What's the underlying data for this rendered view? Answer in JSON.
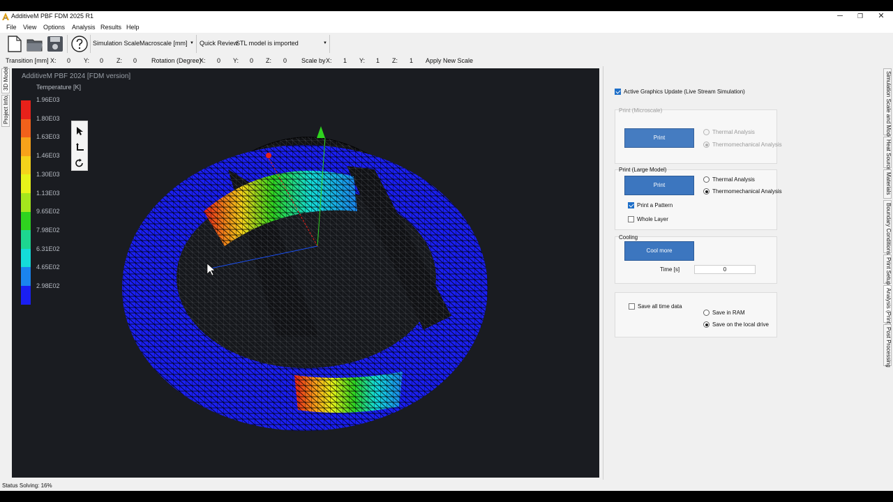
{
  "window": {
    "title": "AdditiveM PBF FDM 2025 R1",
    "minimize": "─",
    "maximize": "❐",
    "close": "✕"
  },
  "menu": [
    "File",
    "View",
    "Options",
    "Analysis",
    "Results",
    "Help"
  ],
  "toolbar": {
    "simulation_scale_label": "Simulation Scale:",
    "simulation_scale_value": "Macroscale [mm]",
    "quick_review_label": "Quick Review",
    "quick_review_value": "STL model is imported"
  },
  "transform": {
    "transition_label": "Transition [mm]",
    "transition": {
      "x": "0",
      "y": "0",
      "z": "0"
    },
    "rotation_label": "Rotation (Degree)",
    "rotation": {
      "x": "0",
      "y": "0",
      "z": "0"
    },
    "scale_label": "Scale by",
    "scale": {
      "x": "1",
      "y": "1",
      "z": "1"
    },
    "x": "X:",
    "y": "Y:",
    "z": "Z:",
    "apply": "Apply New Scale"
  },
  "left_tabs": [
    "3D Model",
    "Project Info."
  ],
  "viewport": {
    "title": "AdditiveM PBF 2024 [FDM version]",
    "legend_title": "Temperature [K]",
    "legend_labels": [
      "1.96E03",
      "1.80E03",
      "1.63E03",
      "1.46E03",
      "1.30E03",
      "1.13E03",
      "9.65E02",
      "7.98E02",
      "6.31E02",
      "4.65E02",
      "2.98E02"
    ],
    "legend_colors": [
      "#e8211a",
      "#f2611b",
      "#f7a21a",
      "#f4d31b",
      "#e7f31a",
      "#a5e61d",
      "#2fd31f",
      "#1dd690",
      "#14dcd9",
      "#1a84ee",
      "#1a1ff2"
    ]
  },
  "panel": {
    "live_stream": "Active Graphics Update (Live Stream Simulation)",
    "micro": {
      "title": "Print (Microscale)",
      "print": "Print",
      "thermal": "Thermal Analysis",
      "thermomech": "Thermomechanical Analysis"
    },
    "large": {
      "title": "Print (Large Model)",
      "print": "Print",
      "thermal": "Thermal Analysis",
      "thermomech": "Thermomechanical Analysis",
      "pattern": "Print a Pattern",
      "whole_layer": "Whole Layer"
    },
    "cooling": {
      "title": "Cooling",
      "button": "Cool more",
      "time_label": "Time [s]",
      "time_value": "0"
    },
    "save": {
      "all_time": "Save all time data",
      "ram": "Save in RAM",
      "local": "Save on the local drive"
    }
  },
  "right_tabs": [
    "Simulation Scale and Model",
    "Heat Source",
    "Materials",
    "Boundary Conditions",
    "Print Setup",
    "Analysis (Print)",
    "Post Processing"
  ],
  "status": "Status   Solving: 16%"
}
